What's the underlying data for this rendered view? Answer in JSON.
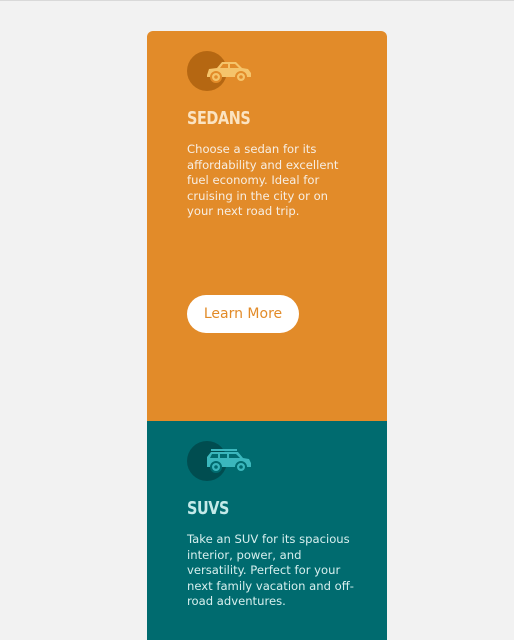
{
  "colors": {
    "page_background": "#f2f2f2",
    "sedans_card": "#e28b29",
    "suvs_card": "#006b6f",
    "sedans_icon": "#f5c46b",
    "suvs_icon": "#3bb7bd"
  },
  "cards": [
    {
      "icon": "sedan-car-icon",
      "title": "SEDANS",
      "text": "Choose a sedan for its affordability and excellent fuel economy. Ideal for cruising in the city or on your next road trip.",
      "button_label": "Learn More"
    },
    {
      "icon": "suv-car-icon",
      "title": "SUVS",
      "text": "Take an SUV for its spacious interior, power, and versatility. Perfect for your next family vacation and off-road adventures."
    }
  ]
}
